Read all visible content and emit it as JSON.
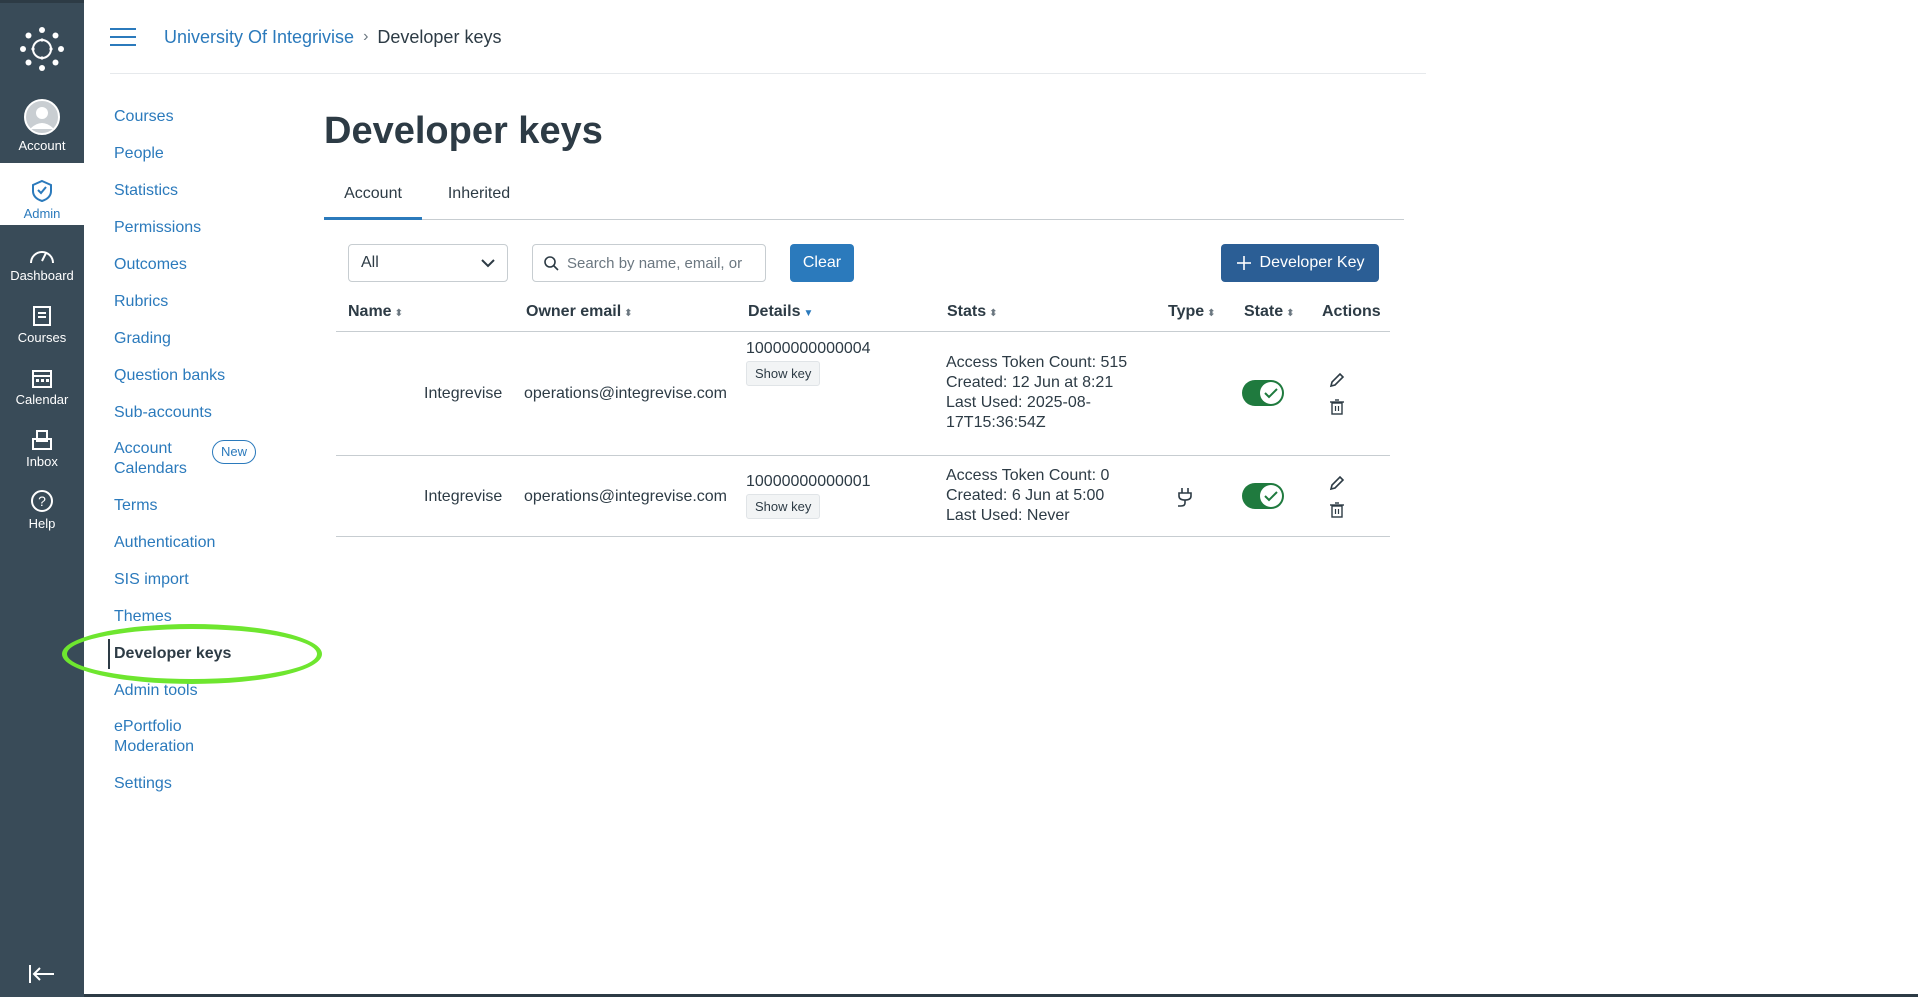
{
  "global_nav": {
    "account": "Account",
    "admin": "Admin",
    "dashboard": "Dashboard",
    "courses": "Courses",
    "calendar": "Calendar",
    "inbox": "Inbox",
    "help": "Help"
  },
  "breadcrumb": {
    "root": "University Of Integrivise",
    "current": "Developer keys"
  },
  "section_nav": {
    "courses": "Courses",
    "people": "People",
    "statistics": "Statistics",
    "permissions": "Permissions",
    "outcomes": "Outcomes",
    "rubrics": "Rubrics",
    "grading": "Grading",
    "question_banks": "Question banks",
    "sub_accounts": "Sub-accounts",
    "account_calendars_1": "Account",
    "account_calendars_2": "Calendars",
    "new_badge": "New",
    "terms": "Terms",
    "authentication": "Authentication",
    "sis_import": "SIS import",
    "themes": "Themes",
    "developer_keys": "Developer keys",
    "admin_tools": "Admin tools",
    "eportfolio_1": "ePortfolio",
    "eportfolio_2": "Moderation",
    "settings": "Settings"
  },
  "page": {
    "title": "Developer keys",
    "tabs": [
      "Account",
      "Inherited"
    ]
  },
  "filters": {
    "select_value": "All",
    "search_placeholder": "Search by name, email, or",
    "clear_label": "Clear",
    "add_label": "Developer Key"
  },
  "table": {
    "headers": {
      "name": "Name",
      "owner_email": "Owner email",
      "details": "Details",
      "stats": "Stats",
      "type": "Type",
      "state": "State",
      "actions": "Actions"
    },
    "rows": [
      {
        "name": "Integrevise",
        "email": "operations@integrevise.com",
        "id": "10000000000004",
        "show_key": "Show key",
        "stats_1": "Access Token Count: 515",
        "stats_2": "Created: 12 Jun at 8:21",
        "stats_3": "Last Used: 2025-08-",
        "stats_4": "17T15:36:54Z"
      },
      {
        "name": "Integrevise",
        "email": "operations@integrevise.com",
        "id": "10000000000001",
        "show_key": "Show key",
        "stats_1": "Access Token Count: 0",
        "stats_2": "Created: 6 Jun at 5:00",
        "stats_3": "Last Used: Never"
      }
    ]
  },
  "colors": {
    "nav_bg": "#394b58",
    "link": "#2b7abc",
    "primary_button": "#2b5e95",
    "toggle_on": "#1f7a3e",
    "highlight": "#6ee62f"
  }
}
